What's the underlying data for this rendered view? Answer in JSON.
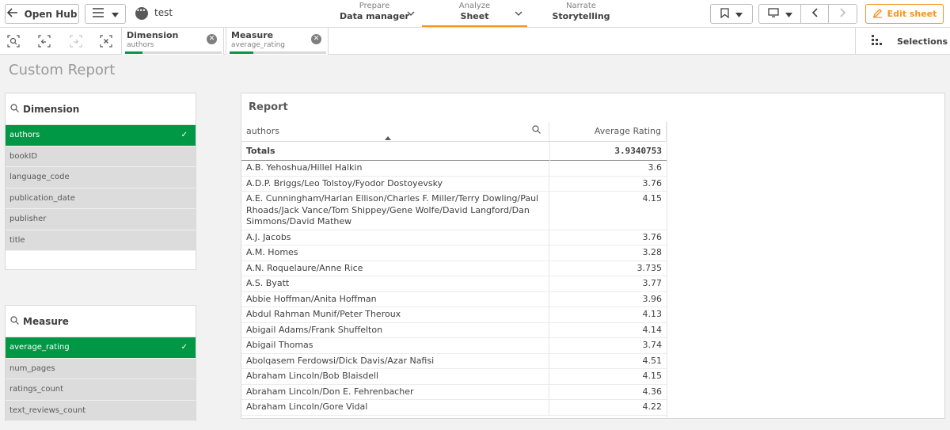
{
  "topbar": {
    "open_hub": "Open Hub",
    "app_name": "test",
    "nav": {
      "prepare_small": "Prepare",
      "prepare_big": "Data manager",
      "analyze_small": "Analyze",
      "analyze_big": "Sheet",
      "narrate_small": "Narrate",
      "narrate_big": "Storytelling"
    },
    "edit_sheet": "Edit sheet",
    "accent_color": "#f7931e"
  },
  "selbar": {
    "chips": [
      {
        "title": "Dimension",
        "value": "authors"
      },
      {
        "title": "Measure",
        "value": "average_rating"
      }
    ],
    "selections_label": "Selections"
  },
  "page_title": "Custom Report",
  "dimension_pane": {
    "title": "Dimension",
    "items": [
      "authors",
      "bookID",
      "language_code",
      "publication_date",
      "publisher",
      "title"
    ],
    "selected": "authors"
  },
  "measure_pane": {
    "title": "Measure",
    "items": [
      "average_rating",
      "num_pages",
      "ratings_count",
      "text_reviews_count"
    ],
    "selected": "average_rating"
  },
  "report": {
    "title": "Report",
    "col1": "authors",
    "col2": "Average Rating",
    "totals_label": "Totals",
    "totals_value": "3.9340753",
    "rows": [
      {
        "author": "A.B. Yehoshua/Hillel Halkin",
        "rating": "3.6"
      },
      {
        "author": "A.D.P. Briggs/Leo Tolstoy/Fyodor Dostoyevsky",
        "rating": "3.76"
      },
      {
        "author": "A.E. Cunningham/Harlan Ellison/Charles F. Miller/Terry Dowling/Paul Rhoads/Jack Vance/Tom Shippey/Gene Wolfe/David Langford/Dan Simmons/David Mathew",
        "rating": "4.15"
      },
      {
        "author": "A.J. Jacobs",
        "rating": "3.76"
      },
      {
        "author": "A.M. Homes",
        "rating": "3.28"
      },
      {
        "author": "A.N. Roquelaure/Anne Rice",
        "rating": "3.735"
      },
      {
        "author": "A.S. Byatt",
        "rating": "3.77"
      },
      {
        "author": "Abbie Hoffman/Anita Hoffman",
        "rating": "3.96"
      },
      {
        "author": "Abdul Rahman Munif/Peter Theroux",
        "rating": "4.13"
      },
      {
        "author": "Abigail Adams/Frank Shuffelton",
        "rating": "4.14"
      },
      {
        "author": "Abigail Thomas",
        "rating": "3.74"
      },
      {
        "author": "Abolqasem Ferdowsi/Dick Davis/Azar Nafisi",
        "rating": "4.51"
      },
      {
        "author": "Abraham Lincoln/Bob Blaisdell",
        "rating": "4.15"
      },
      {
        "author": "Abraham Lincoln/Don E. Fehrenbacher",
        "rating": "4.36"
      },
      {
        "author": "Abraham Lincoln/Gore Vidal",
        "rating": "4.22"
      }
    ]
  },
  "colors": {
    "selected_green": "#009845",
    "accent": "#f7931e"
  }
}
